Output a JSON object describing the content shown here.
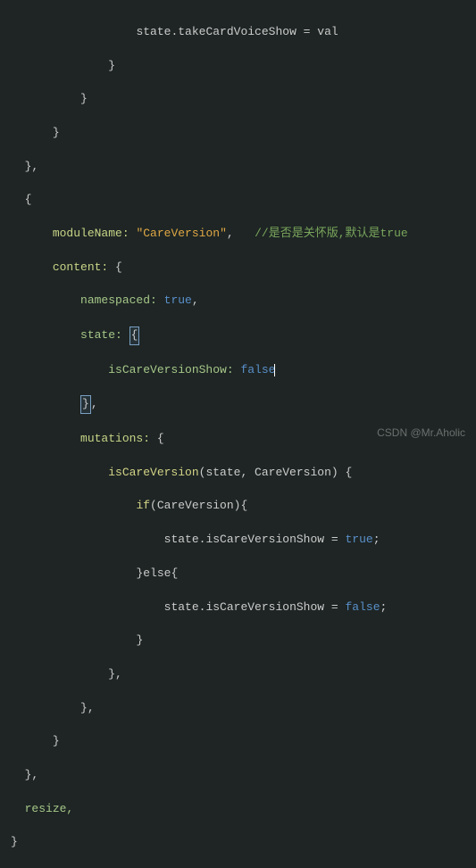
{
  "code": {
    "l1": "state.takeCardVoiceShow = val",
    "l2": "}",
    "l3": "}",
    "l4": "}",
    "l5": "},",
    "l6": "{",
    "l7_prop": "moduleName:",
    "l7_val": "\"CareVersion\"",
    "l7_comma": ",",
    "l7_comment": "//是否是关怀版,默认是true",
    "l8_prop": "content:",
    "l8_brace": "{",
    "l9_prop": "namespaced:",
    "l9_val": "true",
    "l9_comma": ",",
    "l10_prop": "state:",
    "l10_brace": "{",
    "l11_prop": "isCareVersionShow:",
    "l11_val": "false",
    "l12": "},",
    "l13_prop": "mutations:",
    "l13_brace": "{",
    "l14_fn": "isCareVersion",
    "l14_params": "(state, CareVersion) {",
    "l15_if": "if",
    "l15_cond": "(CareVersion){",
    "l16": "state.isCareVersionShow = ",
    "l16_val": "true",
    "l16_semi": ";",
    "l17_else": "}else{",
    "l18": "state.isCareVersionShow = ",
    "l18_val": "false",
    "l18_semi": ";",
    "l19": "}",
    "l20": "},",
    "l21": "},",
    "l22": "}",
    "l23": "},",
    "l24": "resize,",
    "l25": "}"
  },
  "watermark": "CSDN @Mr.Aholic"
}
